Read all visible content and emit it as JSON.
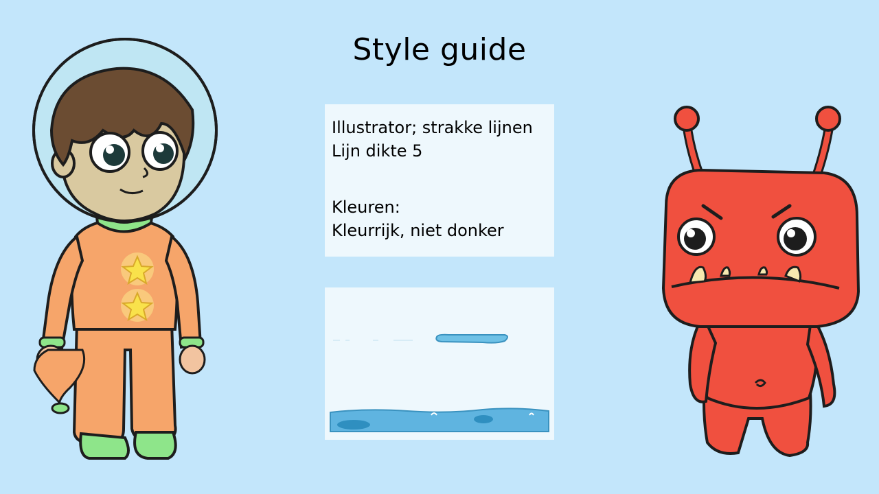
{
  "slide": {
    "title": "Style guide"
  },
  "text_card": {
    "lines": [
      "Illustrator; strakke lijnen",
      "Lijn dikte 5",
      "Kleuren:",
      "Kleurrijk, niet donker"
    ]
  },
  "illustrations": {
    "astronaut": "astronaut-boy-illustration",
    "alien": "red-alien-monster-illustration",
    "level_sample": "water-level-sample-illustration"
  },
  "colors": {
    "background": "#c3e6fb",
    "card": "#eef8fd",
    "suit": "#f6a56a",
    "suit_trim": "#8ee58a",
    "alien": "#f0503f",
    "water": "#5fb4e0"
  }
}
